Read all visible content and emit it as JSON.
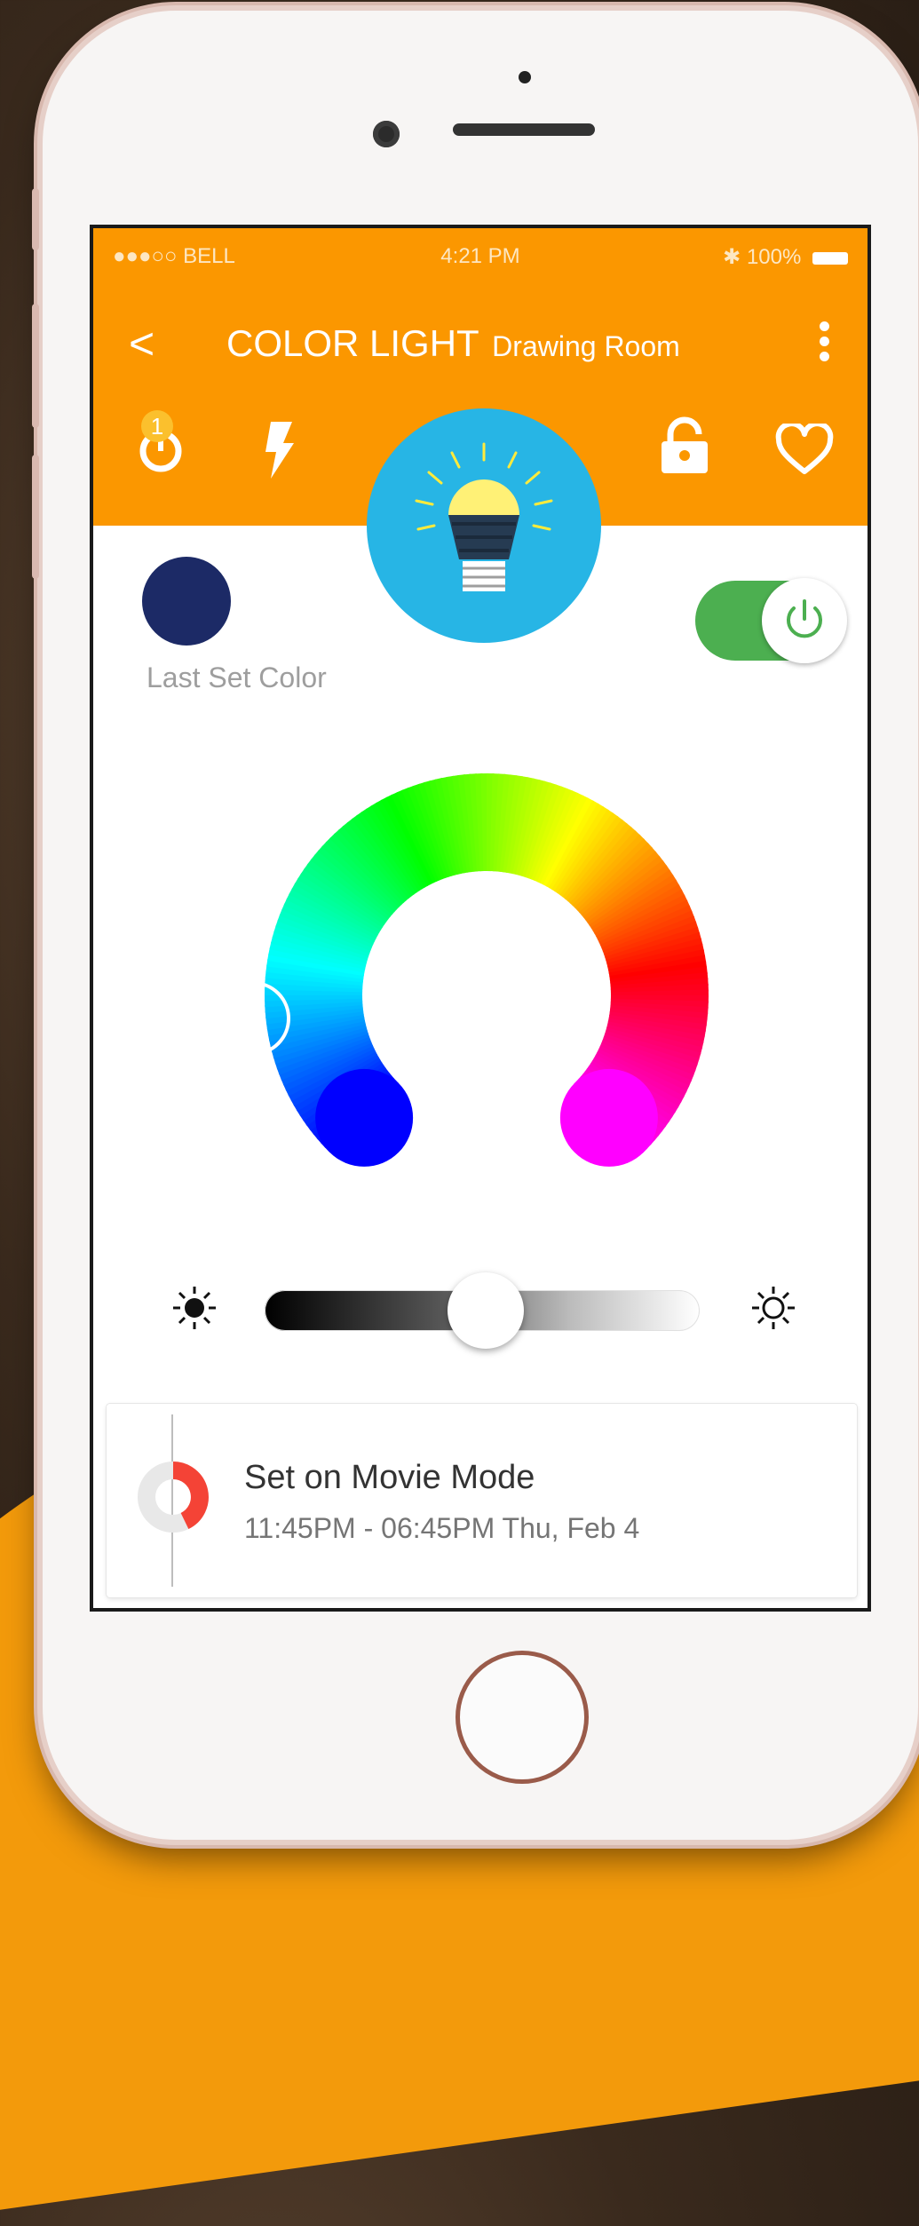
{
  "status_bar": {
    "carrier": "●●●○○ BELL",
    "time": "4:21 PM",
    "battery": "100%"
  },
  "header": {
    "back_label": "<",
    "title": "COLOR LIGHT",
    "subtitle": "Drawing Room",
    "timer_badge": "1",
    "icons": [
      "timer-icon",
      "flash-icon",
      "lightbulb-icon",
      "lock-icon",
      "heart-icon"
    ]
  },
  "color": {
    "last_set_color": "#1c2a66",
    "last_set_label": "Last Set Color",
    "selected_hue": "#2196f3"
  },
  "power": {
    "on": true,
    "accent": "#4caf50"
  },
  "brightness": {
    "level": 0.51
  },
  "schedule": {
    "title": "Set on Movie Mode",
    "time": "11:45PM - 06:45PM Thu, Feb 4"
  },
  "theme": {
    "primary": "#fb9700",
    "bulb_bg": "#27b5e5"
  }
}
